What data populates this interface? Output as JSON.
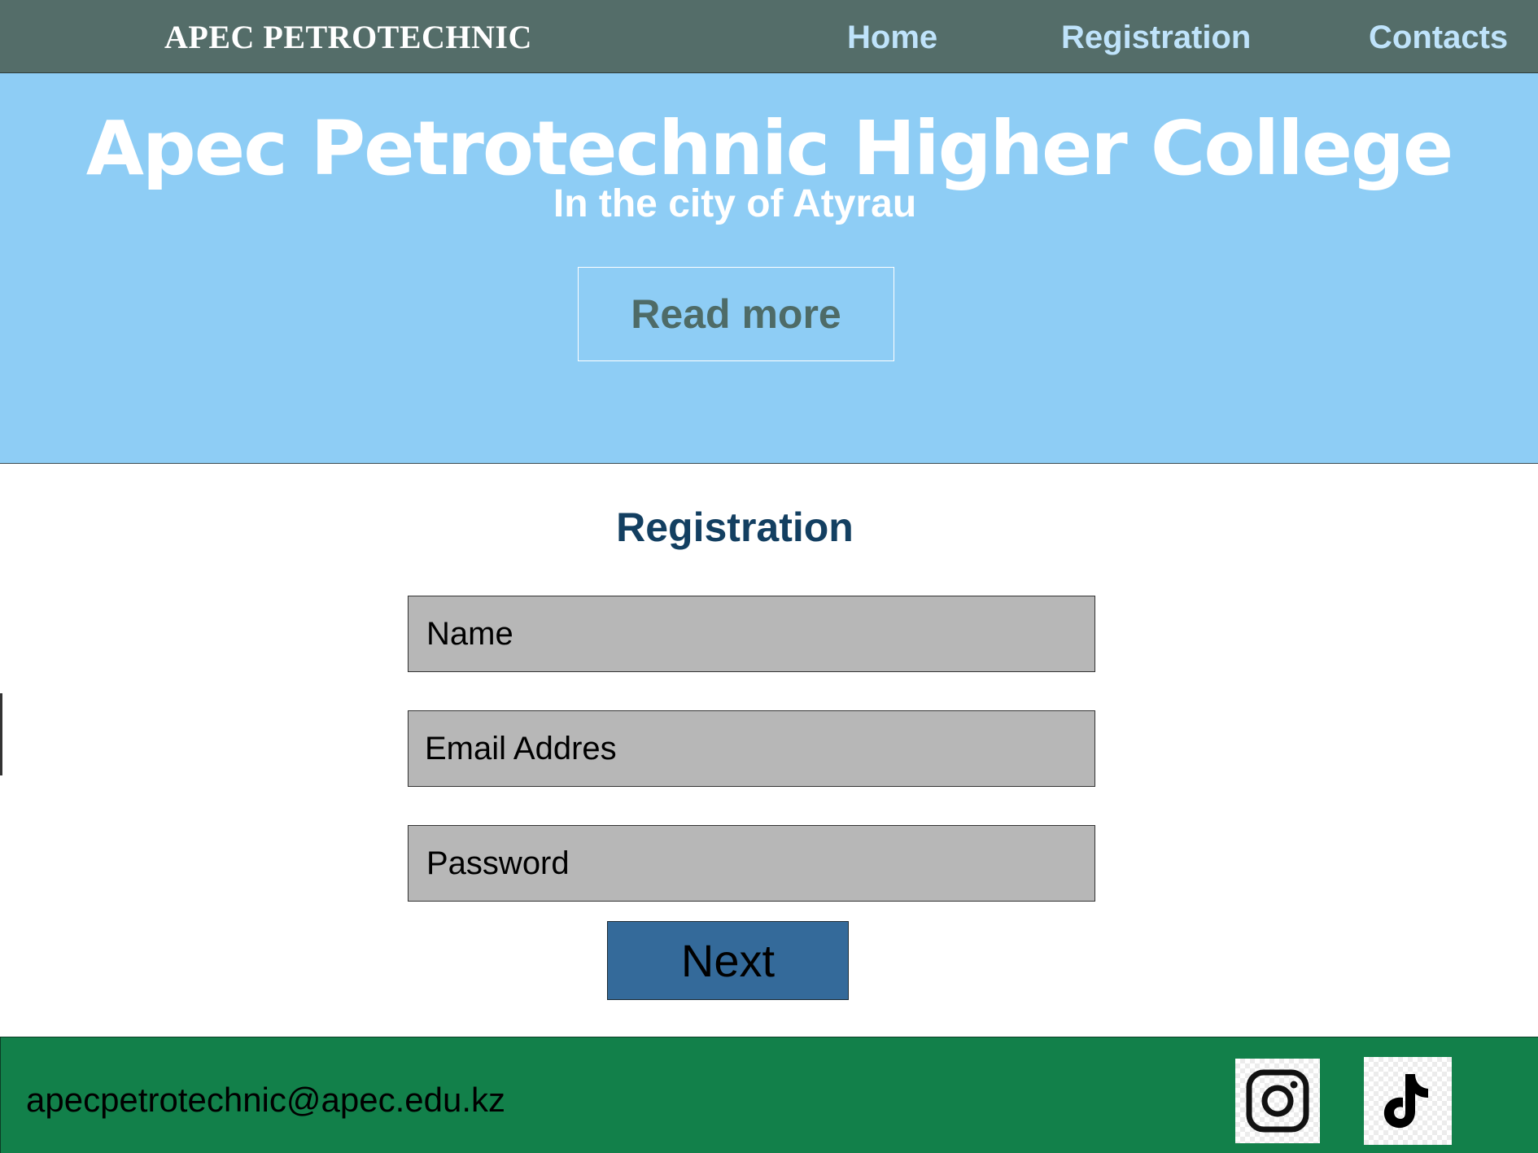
{
  "navbar": {
    "brand": "APEC PETROTECHNIC",
    "links": [
      {
        "label": "Home"
      },
      {
        "label": "Registration"
      },
      {
        "label": "Contacts"
      }
    ]
  },
  "hero": {
    "title": "Apec Petrotechnic Higher College",
    "subtitle": "In the city of Atyrau",
    "read_more_label": "Read more"
  },
  "registration": {
    "title": "Registration",
    "fields": [
      {
        "placeholder": "Name",
        "value": ""
      },
      {
        "placeholder": "Email Addres",
        "value": ""
      },
      {
        "placeholder": "Password",
        "value": ""
      }
    ],
    "next_label": "Next"
  },
  "footer": {
    "email": "apecpetrotechnic@apec.edu.kz",
    "social": [
      {
        "icon": "instagram-icon"
      },
      {
        "icon": "tiktok-icon"
      }
    ]
  },
  "colors": {
    "navbar_bg": "#546d69",
    "nav_link": "#bfe3fb",
    "hero_bg": "#8ecdf5",
    "heading": "#133f61",
    "field_bg": "#b7b7b7",
    "button_bg": "#346a9a",
    "footer_bg": "#12804a"
  }
}
